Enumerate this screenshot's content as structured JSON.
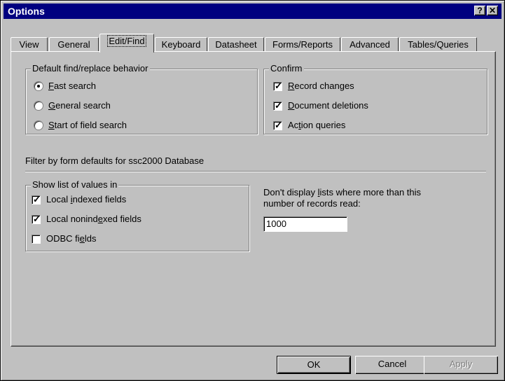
{
  "window": {
    "title": "Options",
    "help_label": "?",
    "close_label": "✕"
  },
  "tabs": [
    {
      "label": "View"
    },
    {
      "label": "General"
    },
    {
      "label": "Edit/Find"
    },
    {
      "label": "Keyboard"
    },
    {
      "label": "Datasheet"
    },
    {
      "label": "Forms/Reports"
    },
    {
      "label": "Advanced"
    },
    {
      "label": "Tables/Queries"
    }
  ],
  "active_tab": "Edit/Find",
  "find_replace": {
    "title": "Default find/replace behavior",
    "selected": "Fast search",
    "options": [
      {
        "pre": "",
        "ul": "F",
        "post": "ast search"
      },
      {
        "pre": "",
        "ul": "G",
        "post": "eneral search"
      },
      {
        "pre": "",
        "ul": "S",
        "post": "tart of field search"
      }
    ]
  },
  "confirm": {
    "title": "Confirm",
    "items": [
      {
        "pre": "",
        "ul": "R",
        "post": "ecord changes",
        "checked": true
      },
      {
        "pre": "",
        "ul": "D",
        "post": "ocument deletions",
        "checked": true
      },
      {
        "pre": "Ac",
        "ul": "t",
        "post": "ion queries",
        "checked": true
      }
    ]
  },
  "filter_heading": "Filter by form defaults for ssc2000 Database",
  "show_list": {
    "title": "Show list of values in",
    "items": [
      {
        "pre": "Local ",
        "ul": "i",
        "post": "ndexed fields",
        "checked": true
      },
      {
        "pre": "Local nonind",
        "ul": "e",
        "post": "xed fields",
        "checked": true
      },
      {
        "pre": "ODBC fi",
        "ul": "e",
        "post": "lds",
        "checked": false
      }
    ]
  },
  "records_limit": {
    "label_pre": "Don't display ",
    "label_ul": "l",
    "label_post": "ists where more than this",
    "label_line2": "number of records read:",
    "value": "1000"
  },
  "buttons": {
    "ok": "OK",
    "cancel": "Cancel",
    "apply": "Apply"
  },
  "check_glyph": "✓"
}
